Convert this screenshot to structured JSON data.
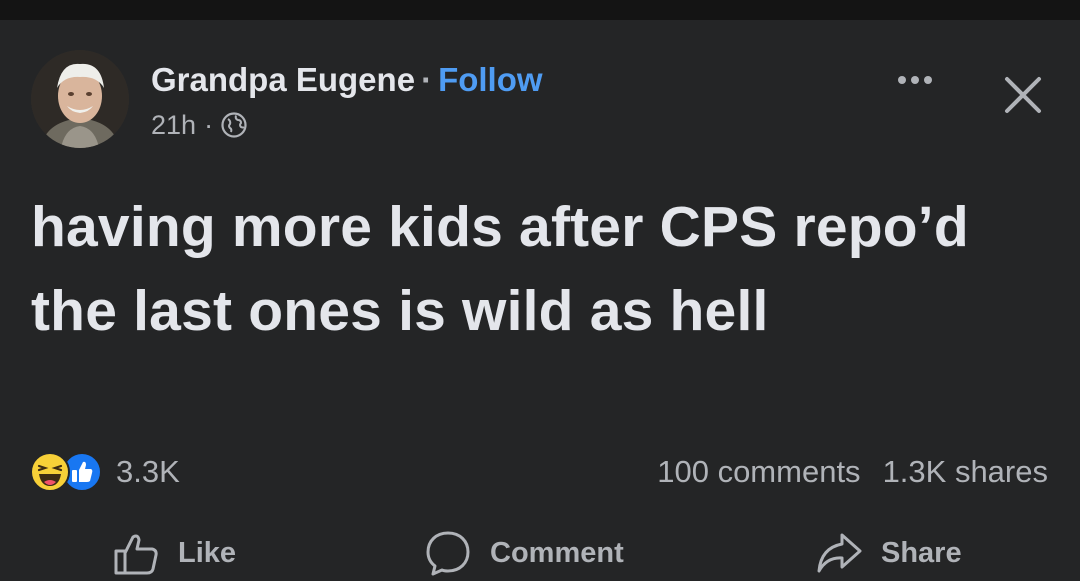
{
  "post": {
    "author_name": "Grandpa Eugene",
    "separator": "·",
    "follow_label": "Follow",
    "timestamp": "21h",
    "privacy_icon": "globe-icon",
    "more_icon": "more-horizontal-icon",
    "close_icon": "close-icon",
    "text": "having more kids after CPS repo’d the last ones is wild as hell"
  },
  "engagement": {
    "reaction_icons": [
      "haha-reaction-icon",
      "like-reaction-icon"
    ],
    "reaction_count": "3.3K",
    "comments": "100 comments",
    "shares": "1.3K shares"
  },
  "actions": {
    "like_label": "Like",
    "comment_label": "Comment",
    "share_label": "Share"
  },
  "colors": {
    "background": "#242526",
    "text": "#e4e6eb",
    "secondary_text": "#b0b3b8",
    "follow_link": "#4f9cf3",
    "like_blue": "#1877f2",
    "haha_yellow": "#f7d038"
  }
}
